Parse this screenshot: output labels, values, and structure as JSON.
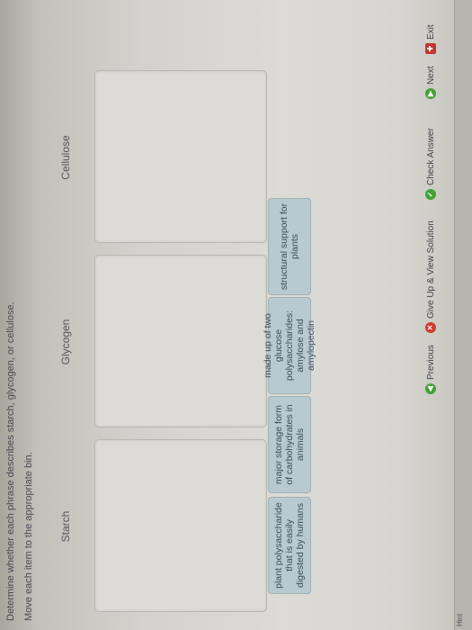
{
  "instructions": {
    "line1": "Determine whether each phrase describes starch, glycogen, or cellulose.",
    "line2": "Move each item to the appropriate bin."
  },
  "bins": [
    {
      "label": "Starch"
    },
    {
      "label": "Glycogen"
    },
    {
      "label": "Cellulose"
    }
  ],
  "items": [
    {
      "text": "plant polysaccharide that is easily digested by humans"
    },
    {
      "text": "major storage form of carbohydrates in animals"
    },
    {
      "text": "made up of two glucose polysaccharides: amylose and amylopectin"
    },
    {
      "text": "structural support for plants"
    }
  ],
  "toolbar": {
    "previous": "Previous",
    "give_up": "Give Up & View Solution",
    "check_answer": "Check Answer",
    "next": "Next",
    "exit": "Exit"
  },
  "footer": {
    "hint": "Hint"
  },
  "icons": {
    "previous": "green-arrow-left-icon",
    "give_up": "red-x-circle-icon",
    "check_answer": "green-check-circle-icon",
    "next": "green-arrow-right-icon",
    "exit": "red-exit-icon"
  }
}
